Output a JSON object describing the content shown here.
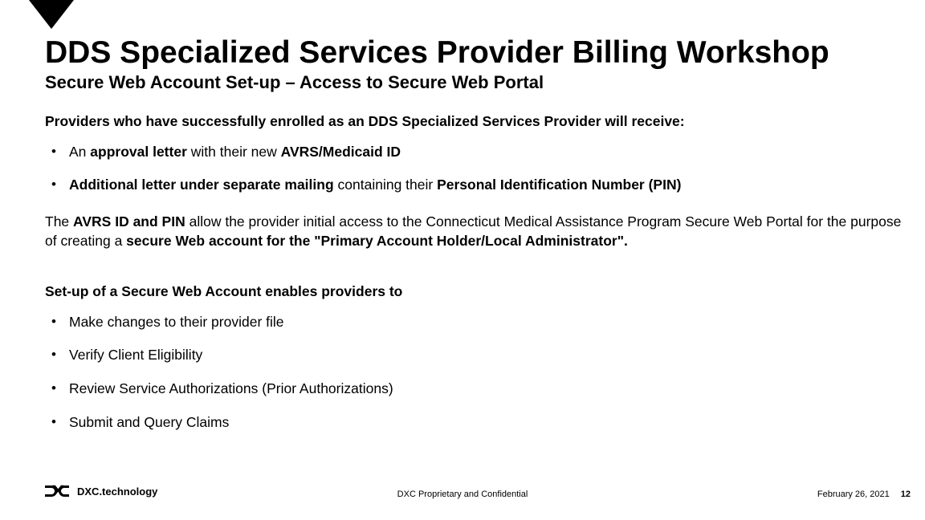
{
  "title": "DDS Specialized Services Provider Billing Workshop",
  "subtitle": "Secure Web Account Set-up – Access to Secure Web Portal",
  "intro": "Providers who have successfully enrolled as an DDS Specialized Services Provider will receive:",
  "b1": {
    "t1": "An ",
    "t2": "approval letter",
    "t3": " with their new ",
    "t4": "AVRS/Medicaid ID"
  },
  "b2": {
    "t1": "Additional letter under separate mailing",
    "t2": " containing their ",
    "t3": "Personal Identification Number (PIN)"
  },
  "mid": {
    "t1": "The ",
    "t2": "AVRS ID and PIN",
    "t3": " allow the provider initial access to the Connecticut Medical Assistance Program Secure Web Portal for the purpose of creating a ",
    "t4": "secure Web account for the \"Primary Account Holder/Local Administrator\"."
  },
  "section2": "Set-up of a Secure Web Account enables providers to",
  "list2": {
    "i1": "Make changes to their provider file",
    "i2": "Verify Client Eligibility",
    "i3": "Review Service Authorizations (Prior Authorizations)",
    "i4": "Submit and Query Claims"
  },
  "brand": "DXC.technology",
  "footer_center": "DXC Proprietary and Confidential",
  "footer_date": "February 26, 2021",
  "footer_page": "12"
}
